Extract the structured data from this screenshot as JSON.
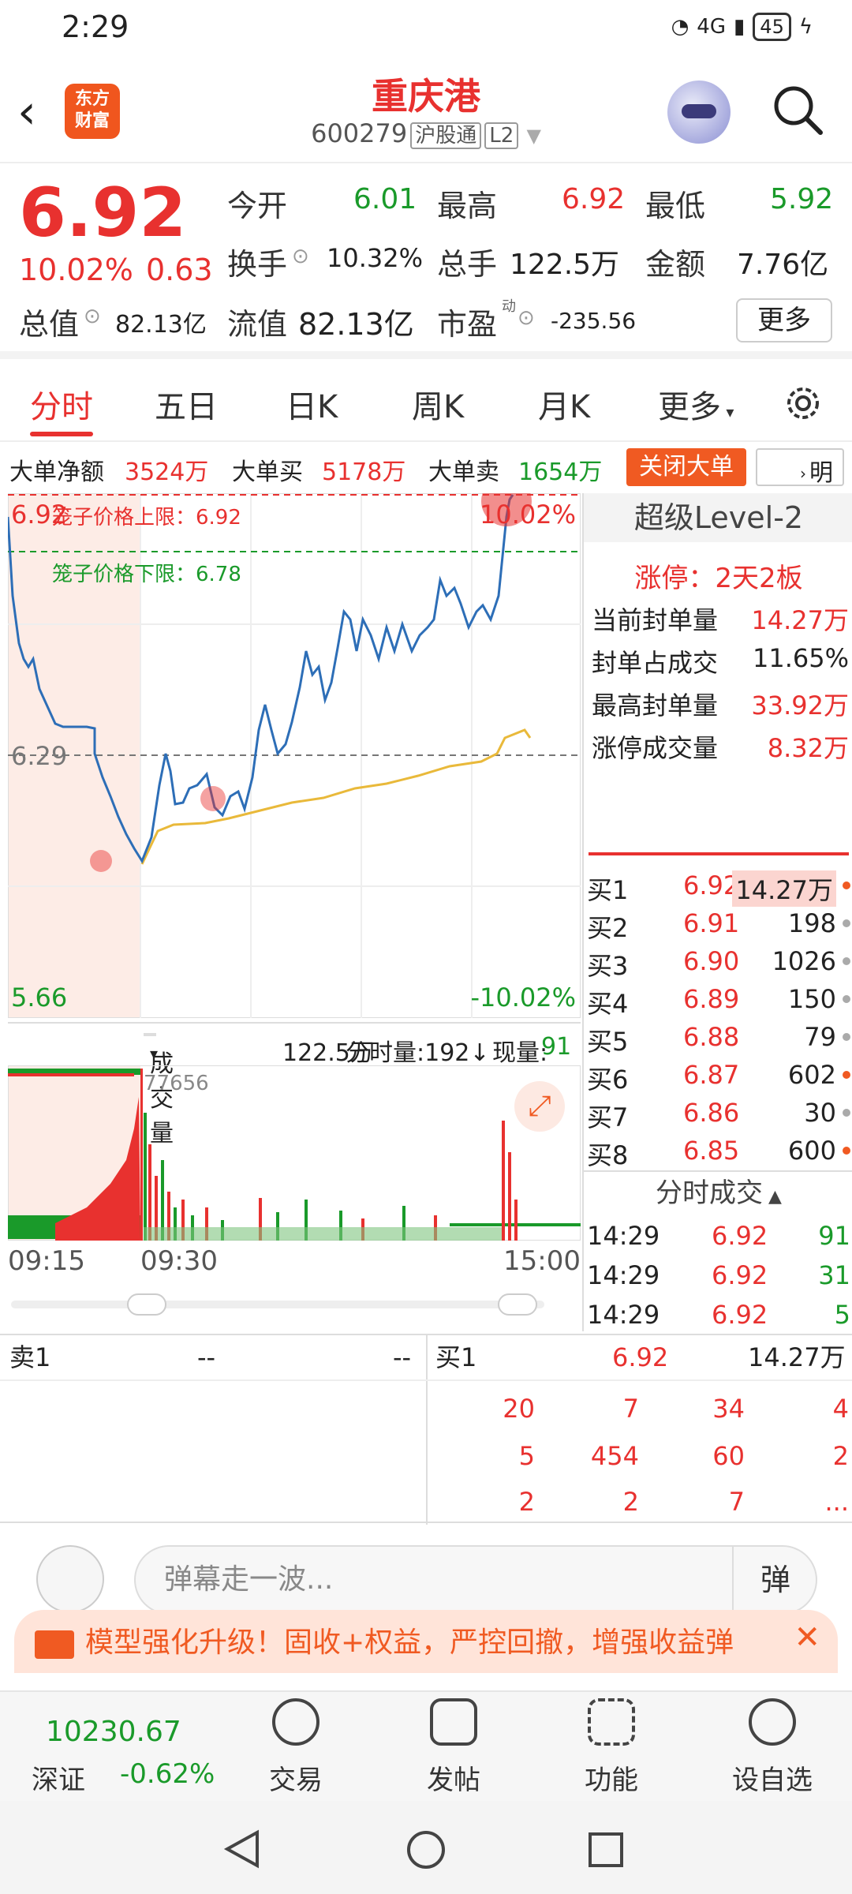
{
  "status": {
    "time": "2:29",
    "signal": "4G",
    "battery": "45"
  },
  "header": {
    "title": "重庆港",
    "code": "600279",
    "tag1": "沪股通",
    "tag2": "L2",
    "logo_line1": "东方",
    "logo_line2": "财富"
  },
  "quote": {
    "price": "6.92",
    "pct": "10.02%",
    "change": "0.63",
    "open_label": "今开",
    "open": "6.01",
    "high_label": "最高",
    "high": "6.92",
    "low_label": "最低",
    "low": "5.92",
    "turnover_label": "换手",
    "turnover": "10.32%",
    "volume_label": "总手",
    "volume": "122.5万",
    "amount_label": "金额",
    "amount": "7.76亿",
    "mktcap_label": "总值",
    "mktcap": "82.13亿",
    "float_label": "流值",
    "float": "82.13亿",
    "pe_label": "市盈",
    "pe_sup": "动",
    "pe": "-235.56",
    "more": "更多"
  },
  "tabs": [
    "分时",
    "五日",
    "日K",
    "周K",
    "月K",
    "更多"
  ],
  "strip": {
    "net_label": "大单净额",
    "net": "3524万",
    "buy_label": "大单买",
    "buy": "5178万",
    "sell_label": "大单卖",
    "sell": "1654万",
    "close": "关闭大单",
    "detail": "明细"
  },
  "chart": {
    "top_price": "6.92",
    "mid_price": "6.29",
    "low_price": "5.66",
    "top_pct": "10.02%",
    "low_pct": "-10.02%",
    "upper_limit": "笼子价格上限：6.92",
    "lower_limit": "笼子价格下限：6.78",
    "vol_select": "成交量",
    "vol_total": "122.5万",
    "vol_minute": "分时量:192↓",
    "vol_now_label": "现量:",
    "vol_now": "91",
    "vol_max": "77656",
    "times": [
      "09:15",
      "09:30",
      "15:00"
    ]
  },
  "right": {
    "title": "超级Level-2",
    "limit_label": "涨停：2天2板",
    "rows": [
      {
        "label": "当前封单量",
        "value": "14.27万"
      },
      {
        "label": "封单占成交",
        "value": "11.65%"
      },
      {
        "label": "最高封单量",
        "value": "33.92万"
      },
      {
        "label": "涨停成交量",
        "value": "8.32万"
      }
    ],
    "bids": [
      {
        "name": "买1",
        "price": "6.92",
        "qty": "14.27万"
      },
      {
        "name": "买2",
        "price": "6.91",
        "qty": "198"
      },
      {
        "name": "买3",
        "price": "6.90",
        "qty": "1026"
      },
      {
        "name": "买4",
        "price": "6.89",
        "qty": "150"
      },
      {
        "name": "买5",
        "price": "6.88",
        "qty": "79"
      },
      {
        "name": "买6",
        "price": "6.87",
        "qty": "602"
      },
      {
        "name": "买7",
        "price": "6.86",
        "qty": "30"
      },
      {
        "name": "买8",
        "price": "6.85",
        "qty": "600"
      }
    ],
    "ticks_title": "分时成交",
    "ticks": [
      {
        "time": "14:29",
        "price": "6.92",
        "qty": "91"
      },
      {
        "time": "14:29",
        "price": "6.92",
        "qty": "31"
      },
      {
        "time": "14:29",
        "price": "6.92",
        "qty": "5"
      }
    ]
  },
  "lower": {
    "sell_label": "卖1",
    "sell_price": "--",
    "sell_qty": "--",
    "buy_label": "买1",
    "buy_price": "6.92",
    "buy_qty": "14.27万",
    "grid": [
      [
        "20",
        "7",
        "34",
        "4"
      ],
      [
        "5",
        "454",
        "60",
        "2"
      ],
      [
        "2",
        "2",
        "7",
        "..."
      ]
    ]
  },
  "comment": {
    "placeholder": "弹幕走一波...",
    "danmu": "弹"
  },
  "banner": {
    "text": "模型强化升级！固收+权益，严控回撤，增强收益弹",
    "close": "✕"
  },
  "bottom": {
    "index_value": "10230.67",
    "index_name": "深证",
    "index_pct": "-0.62%",
    "items": [
      "交易",
      "发帖",
      "功能",
      "设自选"
    ]
  }
}
